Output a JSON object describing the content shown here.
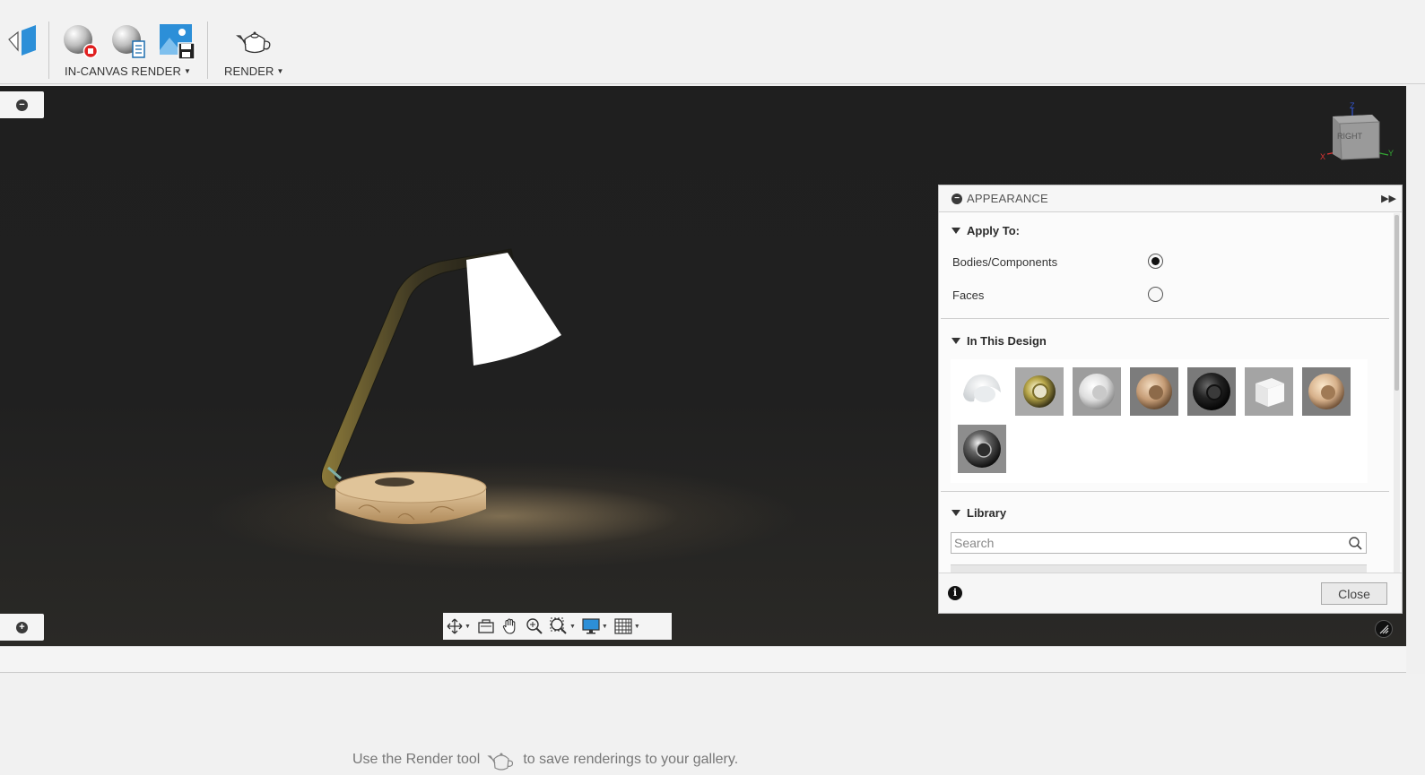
{
  "toolbar": {
    "in_canvas_render_label": "IN-CANVAS RENDER",
    "render_label": "RENDER",
    "colors": {
      "accent_blue": "#1e88d6",
      "stop_red": "#e02020"
    }
  },
  "viewcube": {
    "face_label": "RIGHT",
    "axis_x": "X",
    "axis_y": "Y",
    "axis_z": "Z"
  },
  "appearance_panel": {
    "title": "APPEARANCE",
    "apply_to": {
      "heading": "Apply To:",
      "options": [
        {
          "label": "Bodies/Components",
          "selected": true
        },
        {
          "label": "Faces",
          "selected": false
        }
      ]
    },
    "in_this_design": {
      "heading": "In This Design",
      "materials": [
        "white-glossy-material-icon",
        "gold-chrome-material-icon",
        "pearl-white-material-icon",
        "light-wood-material-icon",
        "black-rubber-material-icon",
        "white-cube-material-icon",
        "pale-wood-material-icon",
        "dark-chrome-material-icon"
      ]
    },
    "library": {
      "heading": "Library",
      "search_placeholder": "Search"
    },
    "close_label": "Close"
  },
  "gallery": {
    "message_before": "Use the Render tool",
    "message_after": "to save renderings to your gallery."
  }
}
